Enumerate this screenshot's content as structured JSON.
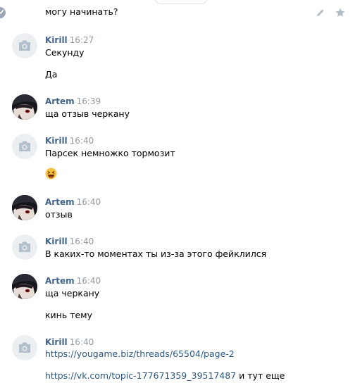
{
  "top": {
    "pill_text": "...",
    "previous_message_text": "могу начинать?"
  },
  "groups": [
    {
      "author": "Kirill",
      "time": "16:27",
      "lines": [
        "Секунду",
        "Да"
      ]
    },
    {
      "author": "Artem",
      "time": "16:39",
      "lines": [
        "ща отзыв черкану"
      ]
    },
    {
      "author": "Kirill",
      "time": "16:40",
      "lines": [
        "Парсек немножко тормозит"
      ],
      "emoji": "laughing-emoji"
    },
    {
      "author": "Artem",
      "time": "16:40",
      "lines": [
        "отзыв"
      ]
    },
    {
      "author": "Kirill",
      "time": "16:40",
      "lines": [
        "В каких-то моментах ты из-за этого фейклился"
      ]
    },
    {
      "author": "Artem",
      "time": "16:40",
      "lines": [
        "ща черкану",
        "кинь тему"
      ]
    },
    {
      "author": "Kirill",
      "time": "16:40",
      "link1": "https://yougame.biz/threads/65504/page-2",
      "link2": "https://vk.com/topic-177671359_39517487",
      "link2_suffix": " и тут еще"
    }
  ],
  "icons": {
    "avatar_placeholder": "camera-icon",
    "edit": "pencil-icon",
    "favorite": "star-icon"
  },
  "colors": {
    "author": "#42648b",
    "time": "#939ba4",
    "link": "#2a5885",
    "avatar_placeholder_bg": "#eceff2"
  }
}
